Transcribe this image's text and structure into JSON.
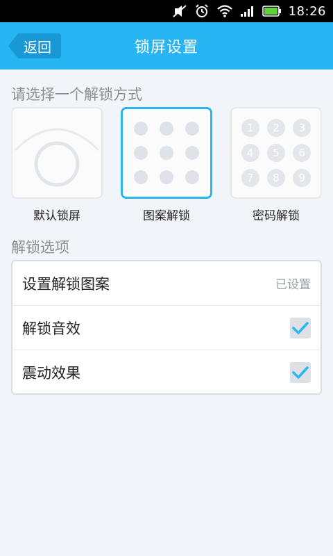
{
  "status_bar": {
    "time": "18:26"
  },
  "header": {
    "back_label": "返回",
    "title": "锁屏设置"
  },
  "unlock_section": {
    "title": "请选择一个解锁方式",
    "options": [
      {
        "label": "默认锁屏",
        "selected": false
      },
      {
        "label": "图案解锁",
        "selected": true
      },
      {
        "label": "密码解锁",
        "selected": false
      }
    ],
    "pin_digits": [
      "1",
      "2",
      "3",
      "4",
      "5",
      "6",
      "7",
      "8",
      "9"
    ]
  },
  "options_section": {
    "title": "解锁选项",
    "rows": [
      {
        "label": "设置解锁图案",
        "status": "已设置"
      },
      {
        "label": "解锁音效",
        "checked": true
      },
      {
        "label": "震动效果",
        "checked": true
      }
    ]
  },
  "colors": {
    "accent": "#26b4f2",
    "selected_border": "#2bb7ee",
    "check": "#29b7ef"
  },
  "icons": [
    "mute-icon",
    "alarm-icon",
    "wifi-icon",
    "signal-icon",
    "battery-icon",
    "back-arrow-icon",
    "checkmark-icon"
  ]
}
